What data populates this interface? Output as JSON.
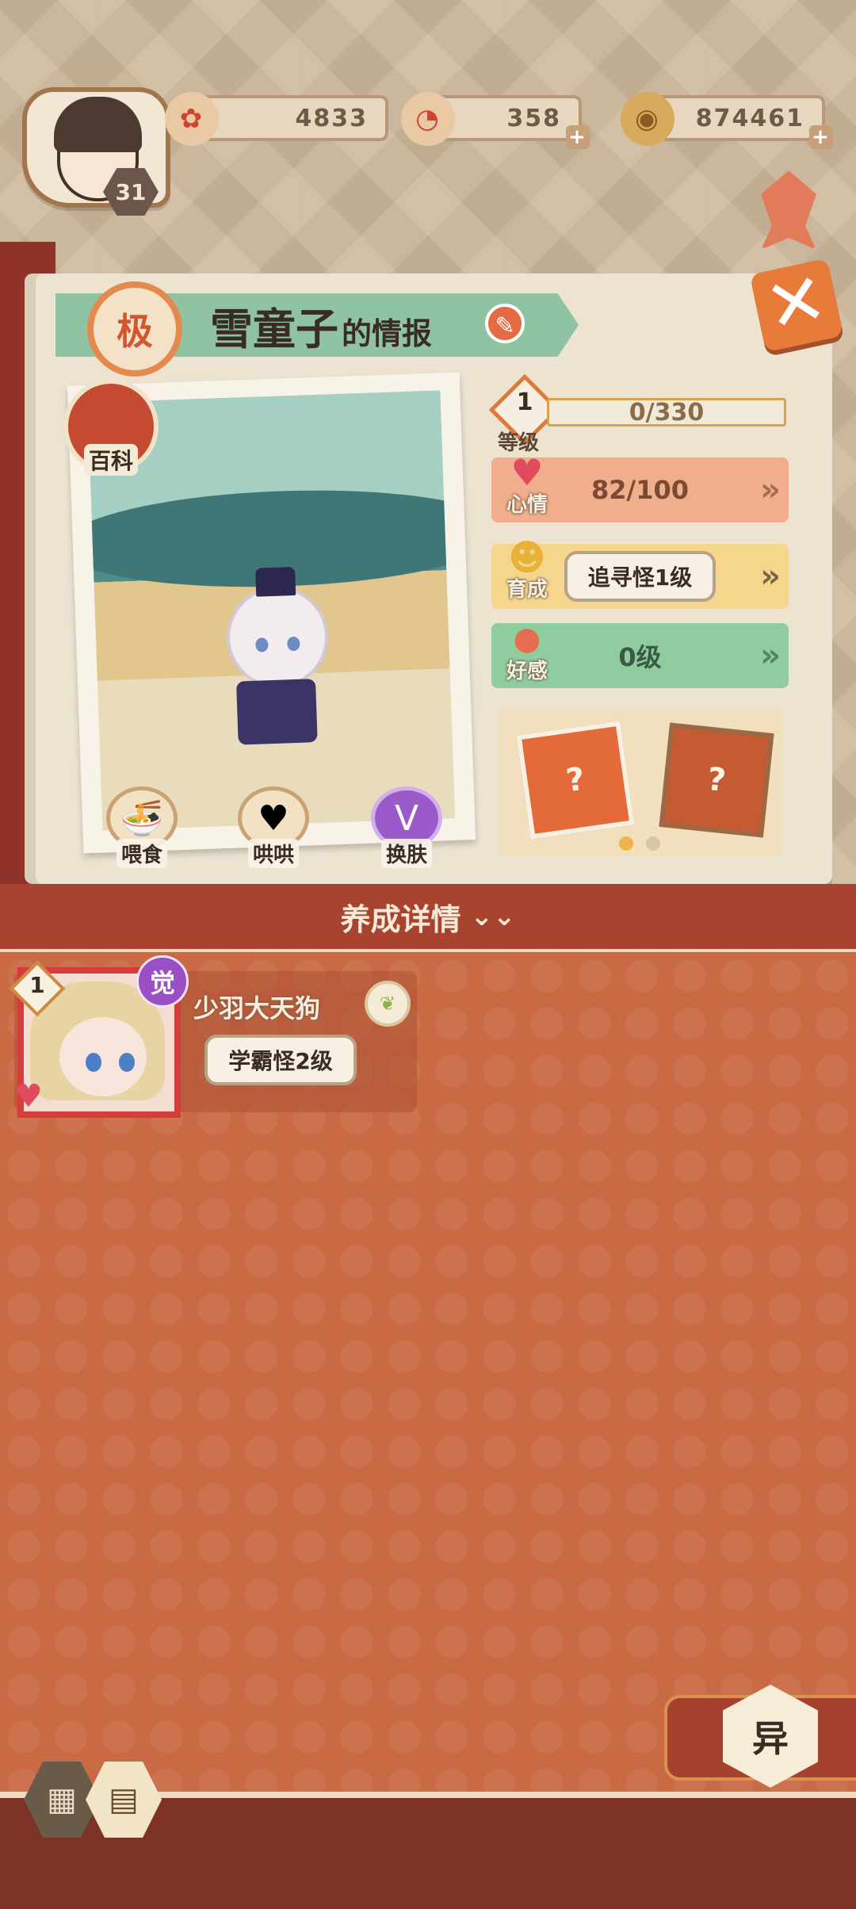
{
  "header": {
    "player_level": "31",
    "currencies": [
      {
        "icon": "plum-blossom-icon",
        "value": "4833",
        "has_plus": false
      },
      {
        "icon": "magatama-icon",
        "value": "358",
        "has_plus": true
      },
      {
        "icon": "coin-icon",
        "value": "874461",
        "has_plus": true
      }
    ]
  },
  "info": {
    "grade": "极",
    "name": "雪童子",
    "title_suffix": "的情报",
    "baike_label": "百科"
  },
  "actions": [
    {
      "label": "喂食",
      "icon": "noodle-bowl-icon"
    },
    {
      "label": "哄哄",
      "icon": "milk-carton-icon"
    },
    {
      "label": "换肤",
      "icon": "outfit-icon"
    }
  ],
  "stats": {
    "level": {
      "label": "等级",
      "value": "1",
      "exp": "0/330"
    },
    "mood": {
      "label": "心情",
      "value": "82/100"
    },
    "growth": {
      "label": "育成",
      "value": "追寻怪1级"
    },
    "affinity": {
      "label": "好感",
      "value": "0级"
    }
  },
  "colors": {
    "mood_bar": "#f0ae8c",
    "growth_bar": "#f5d68c",
    "affinity_bar": "#8fcd9f",
    "accent": "#e46a3a"
  },
  "detail": {
    "header": "养成详情"
  },
  "partner": {
    "level": "1",
    "awake": "觉",
    "name": "少羽大天狗",
    "tag": "学霸怪2级"
  },
  "bottom": {
    "yi_label": "异"
  }
}
